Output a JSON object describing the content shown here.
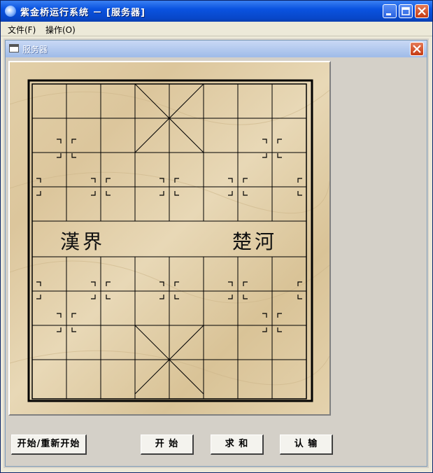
{
  "window": {
    "title": "紫金桥运行系统 － [服务器]"
  },
  "menu": [
    {
      "label": "文件(F)"
    },
    {
      "label": "操作(O)"
    }
  ],
  "child": {
    "title": "服务器"
  },
  "board": {
    "river_left": "漢界",
    "river_right": "楚河"
  },
  "buttons": {
    "restart": "开始/重新开始",
    "start": "开 始",
    "draw": "求 和",
    "resign": "认 输"
  },
  "icons": [
    "app-icon",
    "minimize-icon",
    "maximize-icon",
    "close-icon",
    "window-icon"
  ]
}
